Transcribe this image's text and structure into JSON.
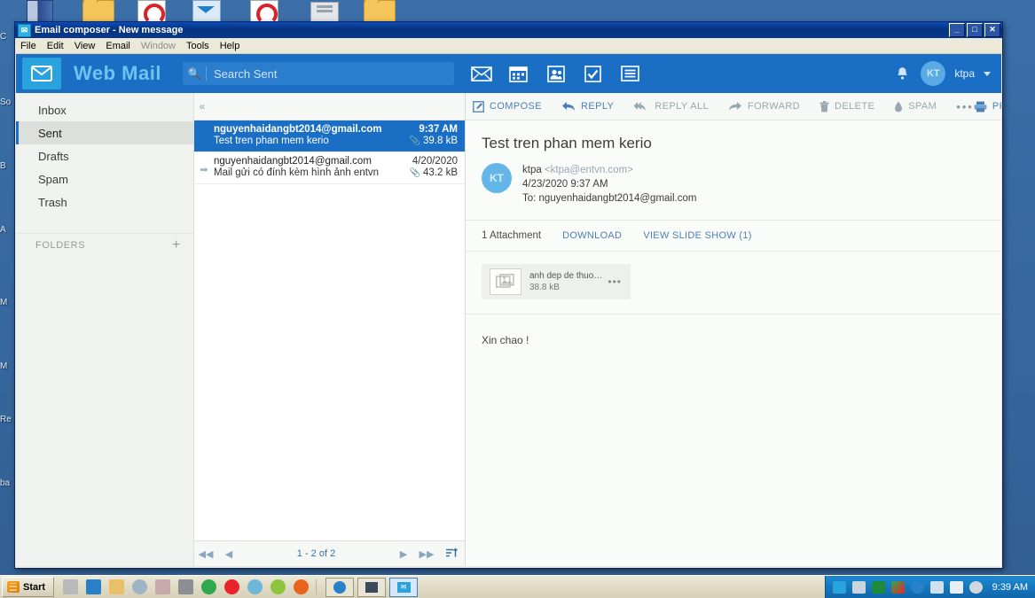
{
  "window": {
    "title": "Email composer - New message",
    "title_icon": "mail-icon",
    "minimize": "_",
    "maximize": "□",
    "close": "✕",
    "menu": [
      "File",
      "Edit",
      "View",
      "Email",
      "Window",
      "Tools",
      "Help"
    ]
  },
  "desktop": {
    "left_labels": [
      "C",
      "So",
      "B",
      "A",
      "M",
      "M",
      "Re",
      "ba"
    ]
  },
  "app": {
    "brand": "Web Mail",
    "brand_icon": "envelope-icon",
    "search": {
      "placeholder": "Search Sent",
      "value": "",
      "icon": "search-icon"
    },
    "nav_icons": [
      {
        "name": "mail-icon",
        "label": "Mail"
      },
      {
        "name": "calendar-icon",
        "label": "Calendar"
      },
      {
        "name": "contacts-icon",
        "label": "Contacts"
      },
      {
        "name": "tasks-icon",
        "label": "Tasks"
      },
      {
        "name": "notes-icon",
        "label": "Notes"
      }
    ],
    "bell_icon": "bell-icon",
    "user": {
      "initials": "KT",
      "name": "ktpa"
    }
  },
  "sidebar": {
    "folders": [
      {
        "label": "Inbox",
        "active": false
      },
      {
        "label": "Sent",
        "active": true
      },
      {
        "label": "Drafts",
        "active": false
      },
      {
        "label": "Spam",
        "active": false
      },
      {
        "label": "Trash",
        "active": false
      }
    ],
    "section_title": "FOLDERS",
    "add_label": "+"
  },
  "toolbar": {
    "collapse": "«",
    "buttons": [
      {
        "label": "COMPOSE",
        "icon": "compose-icon",
        "enabled": true
      },
      {
        "label": "REPLY",
        "icon": "reply-icon",
        "enabled": true
      },
      {
        "label": "REPLY ALL",
        "icon": "reply-all-icon",
        "enabled": false
      },
      {
        "label": "FORWARD",
        "icon": "forward-icon",
        "enabled": false
      },
      {
        "label": "DELETE",
        "icon": "trash-icon",
        "enabled": false
      },
      {
        "label": "SPAM",
        "icon": "spam-drop-icon",
        "enabled": false
      }
    ],
    "more": "•••",
    "print": {
      "label": "PRINT",
      "icon": "printer-icon"
    }
  },
  "messages": [
    {
      "from": "nguyenhaidangbt2014@gmail.com",
      "subject": "Test tren phan mem kerio",
      "date": "9:37 AM",
      "size": "39.8 kB",
      "attachment_icon": "paperclip-icon",
      "selected": true,
      "flag": ""
    },
    {
      "from": "nguyenhaidangbt2014@gmail.com",
      "subject": "Mail gửi có đính kèm hình ảnh entvn",
      "date": "4/20/2020",
      "size": "43.2 kB",
      "attachment_icon": "paperclip-icon",
      "selected": false,
      "flag": "➡"
    }
  ],
  "pager": {
    "first": "◀◀",
    "prev": "◀",
    "info": "1 - 2 of 2",
    "next": "▶",
    "last": "▶▶",
    "sort_icon": "sort-icon"
  },
  "detail": {
    "subject": "Test tren phan mem kerio",
    "avatar_initials": "KT",
    "sender_name": "ktpa",
    "sender_address": "<ktpa@entvn.com>",
    "datetime": "4/23/2020 9:37 AM",
    "recipients": "To: nguyenhaidangbt2014@gmail.com",
    "attachments_label": "1 Attachment",
    "download_label": "DOWNLOAD",
    "slideshow_label": "VIEW SLIDE SHOW (1)",
    "attachment": {
      "name": "anh dep de thuong …",
      "size": "38.8 kB",
      "icon": "image-icon",
      "menu": "•••"
    },
    "body": "Xin chao !"
  },
  "taskbar": {
    "start": "Start",
    "clock": "9:39 AM",
    "quick_launch": [
      "printer-icon",
      "excel-icon",
      "folder-icon",
      "disc-icon",
      "snip-icon",
      "copy-icon",
      "chrome-icon",
      "opera-icon",
      "ie-icon",
      "green-icon",
      "firefox-icon"
    ],
    "task_windows": [
      "browser-icon",
      "terminal-icon",
      "mail-icon"
    ],
    "tray_icons": [
      "mail-icon",
      "console-icon",
      "green-square-icon",
      "update-icon",
      "ie-icon",
      "network-icon",
      "flag-icon",
      "volume-mute-icon"
    ]
  }
}
